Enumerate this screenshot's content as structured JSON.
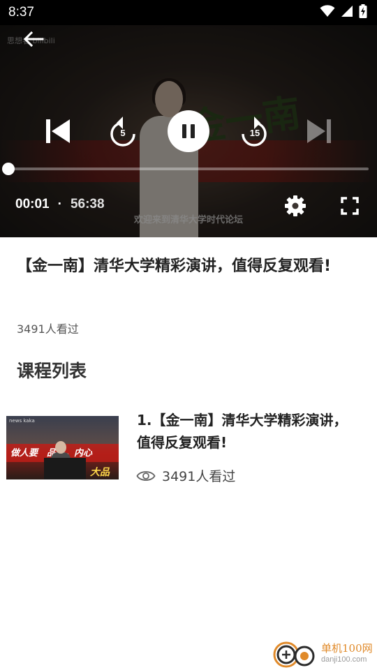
{
  "status_bar": {
    "time": "8:37"
  },
  "player": {
    "watermark": "思想者 bilibili",
    "subtitle": "欢迎来到清华大学时代论坛",
    "background_calligraphy": "金一南",
    "current_time": "00:01",
    "separator": "·",
    "duration": "56:38",
    "replay_seconds": "5",
    "forward_seconds": "15",
    "progress_fraction": 0.0003
  },
  "video": {
    "title": "【金一南】清华大学精彩演讲，值得反复观看!",
    "view_count": "3491人看过"
  },
  "course_list": {
    "heading": "课程列表",
    "items": [
      {
        "title": "1.【金一南】清华大学精彩演讲，值得反复观看!",
        "views": "3491人看过",
        "thumb_text": "做人要　品格，内心",
        "thumb_text2": "大品",
        "thumb_logo": "news kaka"
      }
    ]
  },
  "site_badge": {
    "name": "单机100网",
    "url": "danji100.com"
  },
  "colors": {
    "accent": "#e08a2a",
    "status_bar_bg": "#000000"
  }
}
